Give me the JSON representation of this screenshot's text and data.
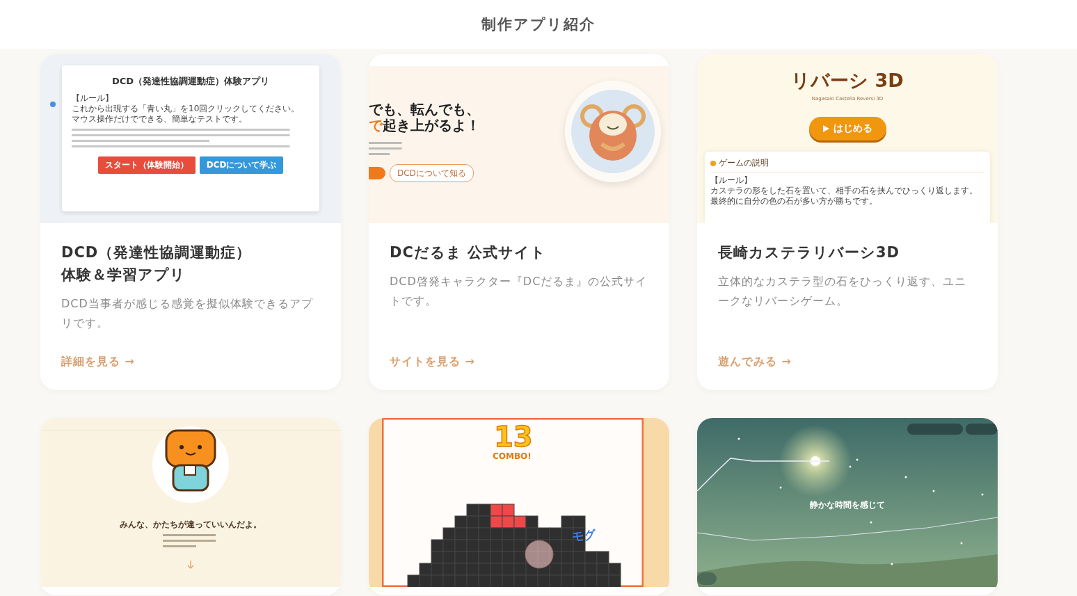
{
  "header": {
    "title": "制作アプリ紹介"
  },
  "cards": [
    {
      "kind": "dcd",
      "preview": {
        "heading": "DCD（発達性協調運動症）体験アプリ",
        "rule_label": "【ルール】",
        "rule_lines": [
          "これから出現する「青い丸」を10回クリックしてください。",
          "マウス操作だけでできる、簡単なテストです。"
        ],
        "buttons": [
          "スタート（体験開始）",
          "DCDについて学ぶ"
        ]
      },
      "title": "DCD（発達性協調運動症）体験＆学習アプリ",
      "description": "DCD当事者が感じる感覚を擬似体験できるアプリです。",
      "link": "詳細を見る →"
    },
    {
      "kind": "daruma",
      "preview": {
        "headline_lines": [
          {
            "text": "でも、転んでも、"
          },
          {
            "accent": "で",
            "text": "起き上がるよ！"
          }
        ],
        "button": "DCDについて知る"
      },
      "title": "DCだるま 公式サイト",
      "description": "DCD啓発キャラクター『DCだるま』の公式サイトです。",
      "link": "サイトを見る →"
    },
    {
      "kind": "reversi",
      "preview": {
        "heading": "リバーシ 3D",
        "subtitle": "Nagasaki Castella Reversi 3D",
        "button": "はじめる",
        "panel_title": "ゲームの説明",
        "rule_label": "【ルール】",
        "rule_lines": [
          "カステラの形をした石を置いて、相手の石を挟んでひっくり返します。",
          "最終的に自分の色の石が多い方が勝ちです。"
        ]
      },
      "title": "長崎カステラリバーシ3D",
      "description": "立体的なカステラ型の石をひっくり返す、ユニークなリバーシゲーム。",
      "link": "遊んでみる →"
    },
    {
      "kind": "mascot",
      "preview": {
        "headline": "みんな、かたちが違っていいんだよ。"
      }
    },
    {
      "kind": "combo",
      "preview": {
        "count": "13",
        "label": "COMBO!",
        "sound": "モグ"
      }
    },
    {
      "kind": "sky",
      "preview": {
        "headline": "静かな時間を感じて"
      }
    }
  ]
}
